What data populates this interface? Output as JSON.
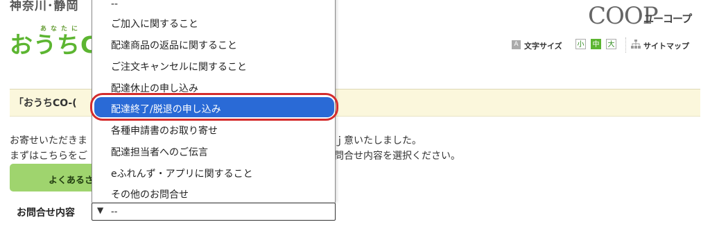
{
  "header": {
    "region": "神奈川･静岡",
    "tagline": "あなたに",
    "brand": "おうちC",
    "coop_logo": "COOP",
    "coop_sub": "ユーコープ",
    "font_size_icon": "A",
    "font_size_label": "文字サイズ",
    "size_small": "小",
    "size_medium": "中",
    "size_large": "大",
    "sitemap_label": "サイトマップ"
  },
  "notice": {
    "title": "「おうちCO-("
  },
  "body": {
    "line1_left": "お寄せいただきま",
    "line2_left": "まずはこちらをご",
    "line1_right": "ｊ意いたしました。",
    "line2_right": "問合せ内容を選択ください。",
    "faq_button": "よくあるさ"
  },
  "form": {
    "inquiry_label": "お問合せ内容",
    "select_arrow": "▼",
    "select_value": "--"
  },
  "dropdown": {
    "options": [
      "--",
      "ご加入に関すること",
      "配達商品の返品に関すること",
      "ご注文キャンセルに関すること",
      "配達休止の申し込み",
      "配達終了/脱退の申し込み",
      "各種申請書のお取り寄せ",
      "配達担当者へのご伝言",
      "eふれんず・アプリに関すること",
      "その他のお問合せ"
    ],
    "selected_index": 5
  },
  "colors": {
    "brand_green": "#5cb531",
    "faq_green": "#9fd46e",
    "highlight_blue": "#2a6ad6",
    "annotation_red": "#d42c2c",
    "notice_bg": "#fbf7dc"
  }
}
